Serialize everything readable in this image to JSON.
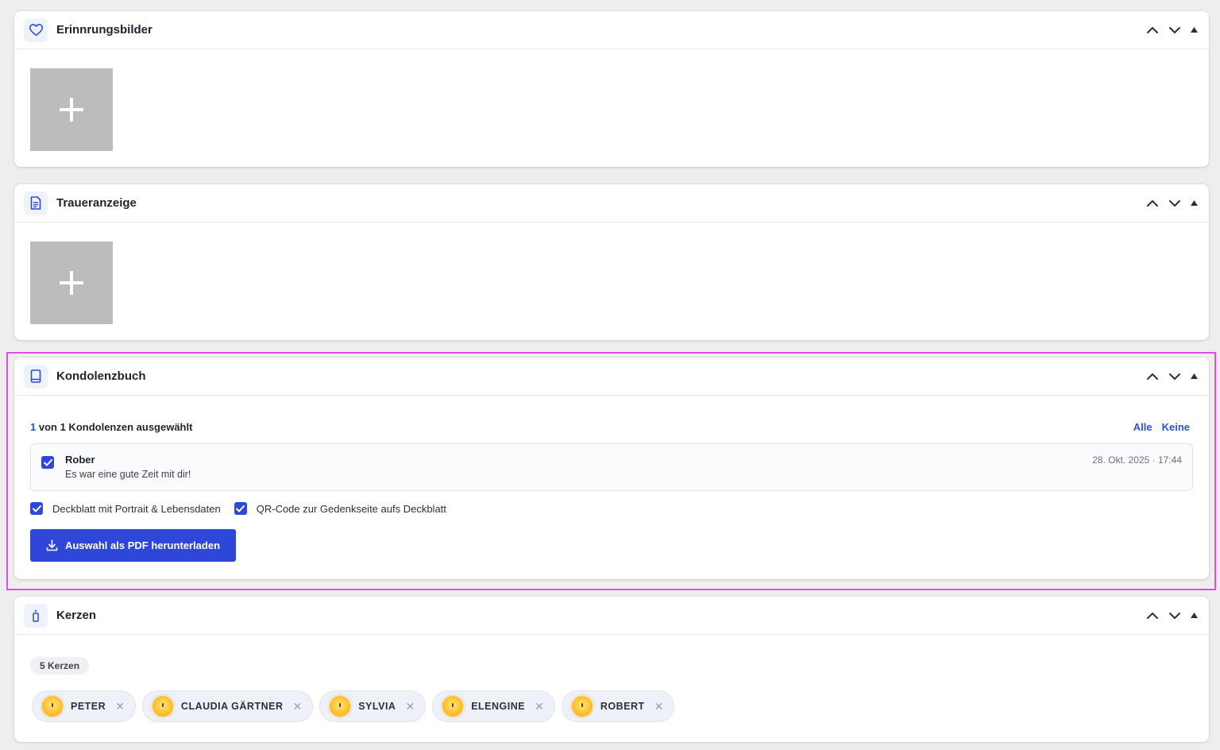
{
  "colors": {
    "accent": "#2f47d8",
    "link": "#2d4fd6",
    "tile": "#bdbbbb",
    "highlight": "#e34be6"
  },
  "panels": {
    "memories": {
      "title": "Erinnrungsbilder",
      "icon": "heart-icon"
    },
    "obituary": {
      "title": "Traueranzeige",
      "icon": "document-icon"
    },
    "condolences": {
      "title": "Kondolenzbuch",
      "icon": "book-icon",
      "selected_count": "1",
      "selected_suffix": "von 1 Kondolenzen ausgewählt",
      "select_all": "Alle",
      "select_none": "Keine",
      "entries": [
        {
          "name": "Rober",
          "text": "Es war eine gute Zeit mit dir!",
          "date": "28. Okt. 2025 · 17:44",
          "checked": true
        }
      ],
      "options": [
        {
          "label": "Deckblatt mit Portrait & Lebensdaten",
          "checked": true
        },
        {
          "label": "QR-Code zur Gedenkseite aufs Deckblatt",
          "checked": true
        }
      ],
      "download_label": "Auswahl als PDF herunterladen"
    },
    "candles": {
      "title": "Kerzen",
      "icon": "candle-icon",
      "count_label": "5 Kerzen",
      "items": [
        "PETER",
        "CLAUDIA GÄRTNER",
        "SYLVIA",
        "ELENGINE",
        "ROBERT"
      ]
    }
  }
}
